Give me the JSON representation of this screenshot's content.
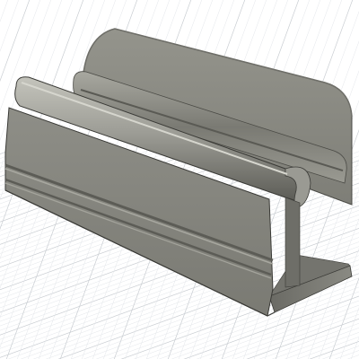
{
  "viewport": {
    "background": "#ffffff",
    "grid_color": "#c9cdd2",
    "grid_minor_color": "#e3e6ea",
    "grid_visible": true
  },
  "model": {
    "kind": "phone-stand",
    "body_color": "#8a8a82",
    "shadow_color": "#5c5c56",
    "highlight_color": "#b4b4ac",
    "edge_color": "#3a3a36"
  }
}
